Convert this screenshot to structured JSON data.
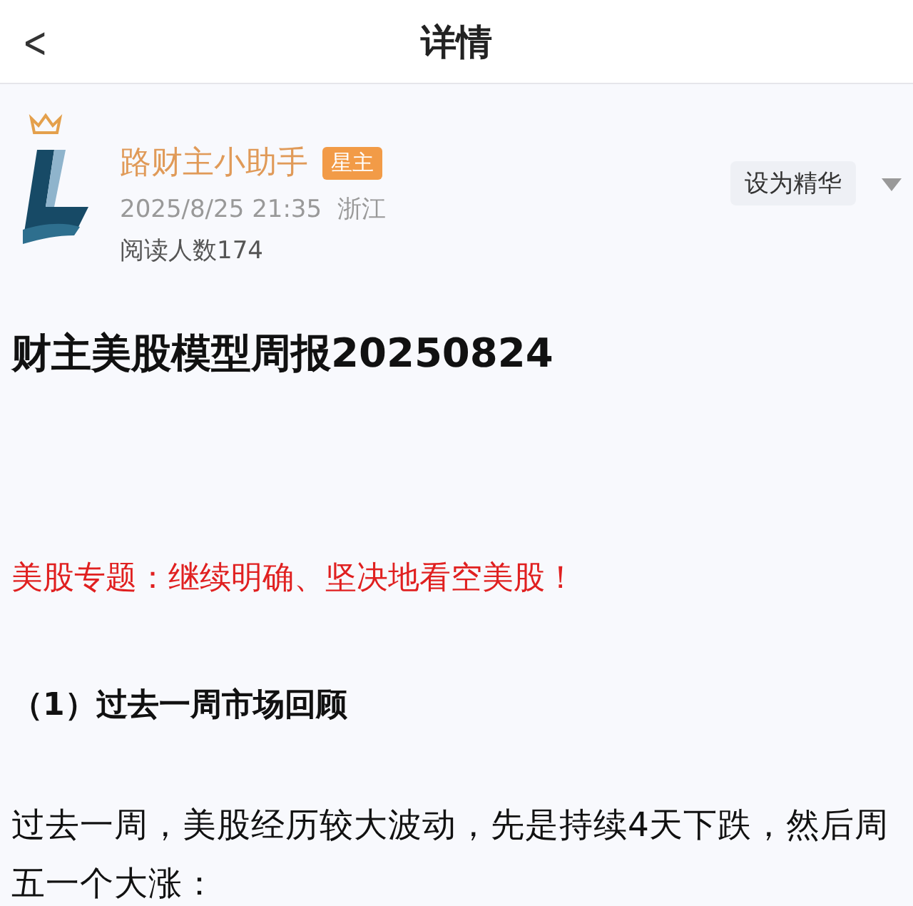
{
  "nav": {
    "back": "<",
    "title": "详情"
  },
  "post": {
    "author": "路财主小助手",
    "badge": "星主",
    "time": "2025/8/25 21:35",
    "location": "浙江",
    "reads": "阅读人数174",
    "action": "设为精华",
    "title": "财主美股模型周报20250824",
    "blocks": [
      {
        "kind": "highlight",
        "text": "美股专题：继续明确、坚决地看空美股！"
      },
      {
        "kind": "heading",
        "text": "（1）过去一周市场回顾"
      },
      {
        "kind": "paragraph",
        "text": "过去一周，美股经历较大波动，先是持续4天下跌，然后周五一个大涨："
      }
    ]
  }
}
